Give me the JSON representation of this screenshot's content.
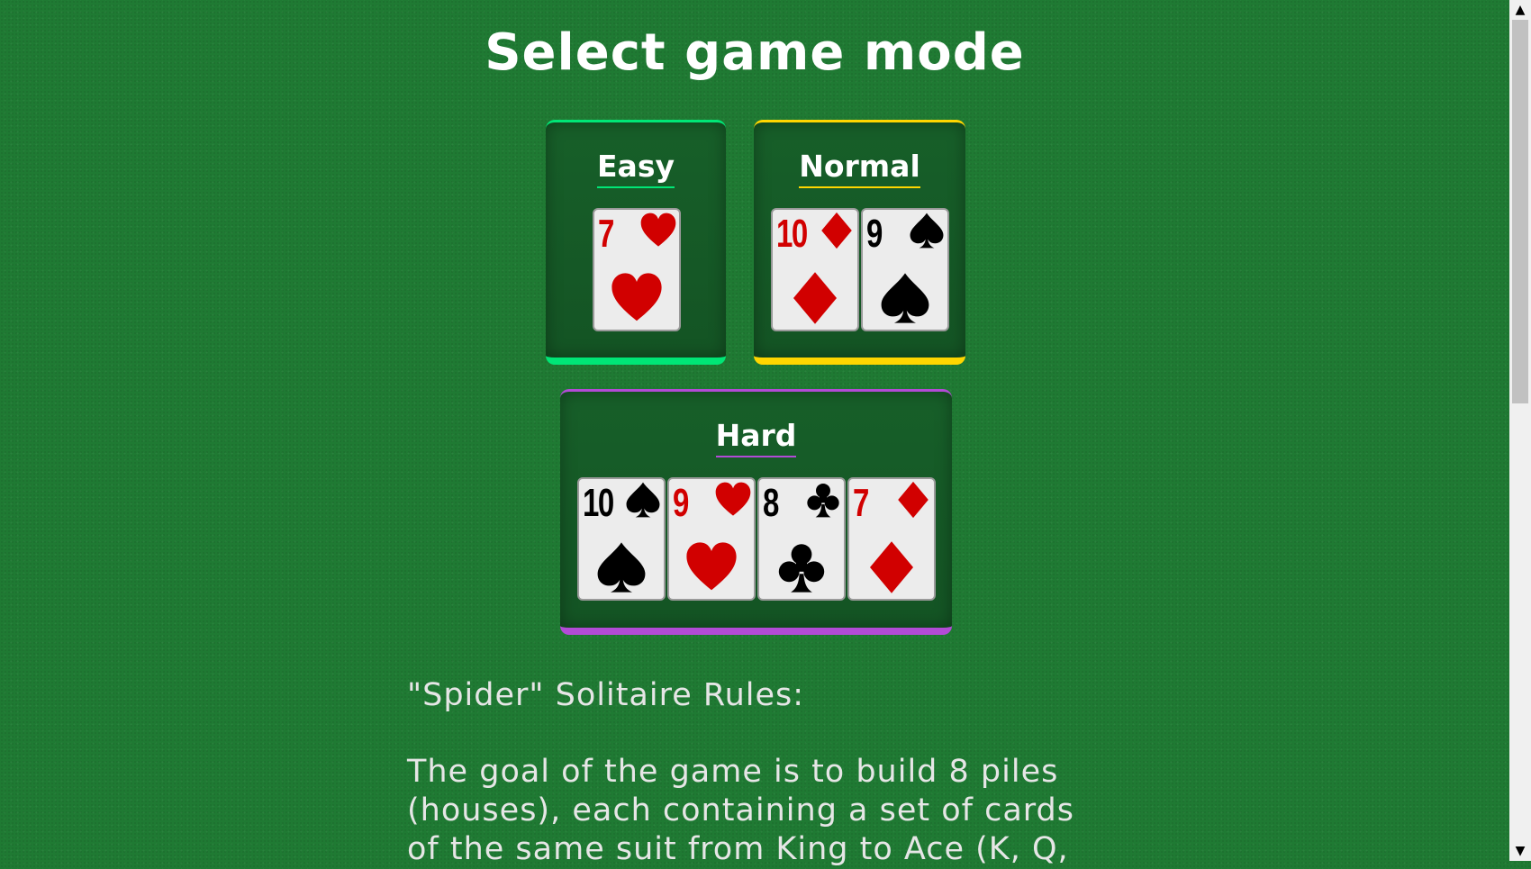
{
  "title": "Select game mode",
  "modes": [
    {
      "label": "Easy",
      "accent": "#00e676",
      "cards": [
        {
          "rank": "7",
          "suit": "hearts",
          "color": "red"
        }
      ]
    },
    {
      "label": "Normal",
      "accent": "#ffd600",
      "cards": [
        {
          "rank": "10",
          "suit": "diamonds",
          "color": "red"
        },
        {
          "rank": "9",
          "suit": "spades",
          "color": "black"
        }
      ]
    },
    {
      "label": "Hard",
      "accent": "#b24bd6",
      "cards": [
        {
          "rank": "10",
          "suit": "spades",
          "color": "black"
        },
        {
          "rank": "9",
          "suit": "hearts",
          "color": "red"
        },
        {
          "rank": "8",
          "suit": "clubs",
          "color": "black"
        },
        {
          "rank": "7",
          "suit": "diamonds",
          "color": "red"
        }
      ]
    }
  ],
  "rules": {
    "heading": "\"Spider\" Solitaire Rules:",
    "body": "The goal of the game is to build 8 piles (houses), each containing a set of cards of the same suit from King to Ace (K, Q,"
  },
  "scrollbar": {
    "up_icon": "scroll-up-arrow-icon",
    "down_icon": "scroll-down-arrow-icon"
  }
}
